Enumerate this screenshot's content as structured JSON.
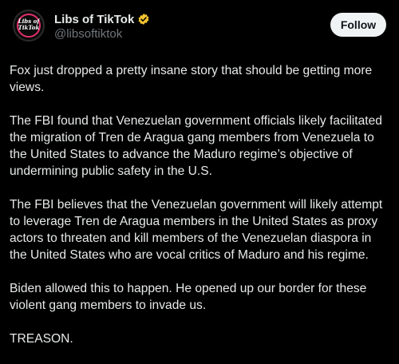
{
  "account": {
    "display_name": "Libs of TikTok",
    "handle": "@libsoftiktok",
    "avatar_text": "Libs of\nTikTok",
    "verified": true,
    "verified_color": "#f4c430"
  },
  "actions": {
    "follow_label": "Follow"
  },
  "post": {
    "paragraphs": [
      "Fox just dropped a pretty insane story that should be getting more views.",
      "The FBI found that Venezuelan government officials likely facilitated the migration of Tren de Aragua gang members from Venezuela to the United States to advance the Maduro regime’s objective of undermining public safety in the U.S.",
      "The FBI believes that the Venezuelan government will likely attempt to leverage Tren de Aragua members in the United States as proxy actors to threaten and kill members of the Venezuelan diaspora in the United States who are vocal critics of Maduro and his regime.",
      "Biden allowed this to happen. He opened up our border for these violent gang members to invade us.",
      "TREASON."
    ]
  },
  "colors": {
    "background": "#000000",
    "text": "#e7e9ea",
    "muted": "#71767b",
    "button_bg": "#eff3f4"
  }
}
